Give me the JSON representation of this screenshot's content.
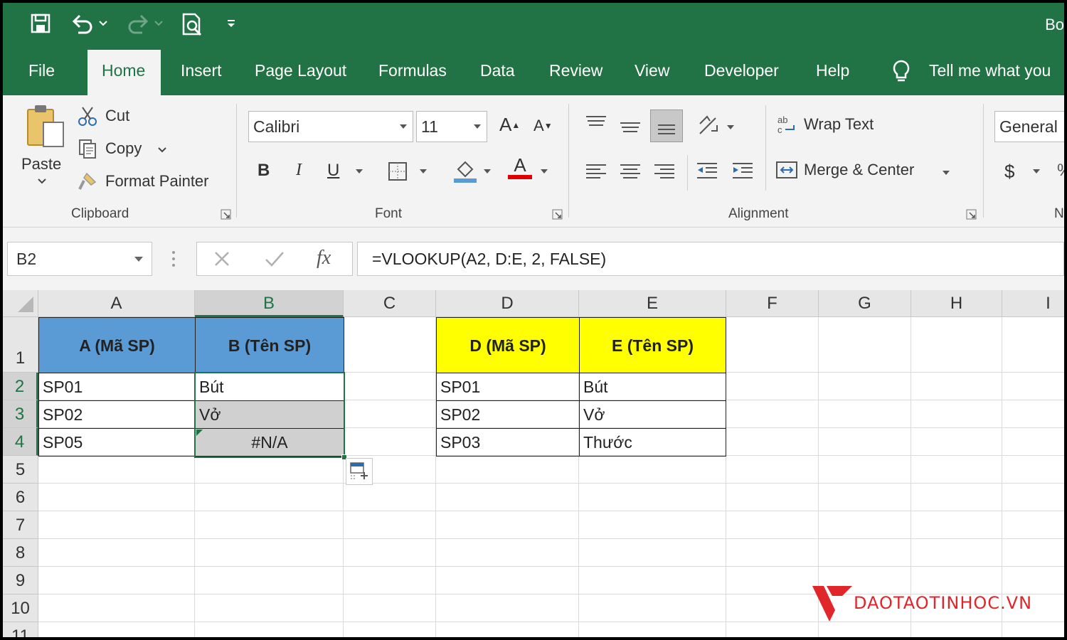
{
  "window": {
    "title": "Bo"
  },
  "tabs": [
    "File",
    "Home",
    "Insert",
    "Page Layout",
    "Formulas",
    "Data",
    "Review",
    "View",
    "Developer",
    "Help"
  ],
  "tell_me": "Tell me what you",
  "clipboard": {
    "paste": "Paste",
    "cut": "Cut",
    "copy": "Copy",
    "format_painter": "Format Painter",
    "label": "Clipboard"
  },
  "font": {
    "name": "Calibri",
    "size": "11",
    "bold": "B",
    "italic": "I",
    "underline": "U",
    "grow": "A",
    "shrink": "A",
    "color_a": "A",
    "label": "Font"
  },
  "alignment": {
    "wrap_text": "Wrap Text",
    "merge_center": "Merge & Center",
    "label": "Alignment"
  },
  "number": {
    "format": "General",
    "currency": "$",
    "label": "N"
  },
  "formula_bar": {
    "name_box": "B2",
    "fx": "fx",
    "formula": "=VLOOKUP(A2, D:E, 2, FALSE)"
  },
  "columns": [
    "A",
    "B",
    "C",
    "D",
    "E",
    "F",
    "G",
    "H",
    "I"
  ],
  "rows": [
    "1",
    "2",
    "3",
    "4",
    "5",
    "6",
    "7",
    "8",
    "9",
    "10",
    "11"
  ],
  "sheet": {
    "A1": "A (Mã SP)",
    "B1": "B (Tên SP)",
    "D1": "D (Mã SP)",
    "E1": "E (Tên SP)",
    "A2": "SP01",
    "B2": "Bút",
    "D2": "SP01",
    "E2": "Bút",
    "A3": "SP02",
    "B3": "Vở",
    "D3": "SP02",
    "E3": "Vở",
    "A4": "SP05",
    "B4": "#N/A",
    "D4": "SP03",
    "E4": "Thước"
  },
  "colors": {
    "excel_green": "#217346",
    "header_blue": "#5b9bd5",
    "header_yellow": "#ffff00",
    "selection_gray": "#d0d0d0",
    "watermark_red": "#e0262b"
  },
  "watermark": "DAOTAOTINHOC.VN"
}
